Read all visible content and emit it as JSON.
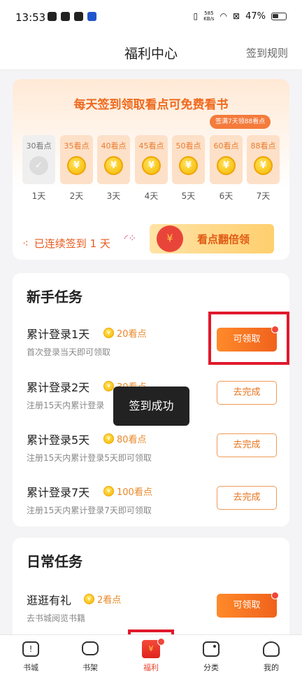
{
  "status_bar": {
    "time": "13:53",
    "net_speed_value": "585",
    "net_speed_unit": "KB/s",
    "battery": "47%"
  },
  "header": {
    "title": "福利中心",
    "rules_link": "签到规则"
  },
  "checkin": {
    "title": "每天签到领取看点可免费看书",
    "bonus_tag": "签满7天领88看点",
    "coin_symbol": "¥",
    "days": [
      {
        "points": "30看点",
        "label": "1天",
        "claimed": true
      },
      {
        "points": "35看点",
        "label": "2天",
        "claimed": false
      },
      {
        "points": "40看点",
        "label": "3天",
        "claimed": false
      },
      {
        "points": "45看点",
        "label": "4天",
        "claimed": false
      },
      {
        "points": "50看点",
        "label": "5天",
        "claimed": false
      },
      {
        "points": "60看点",
        "label": "6天",
        "claimed": false
      },
      {
        "points": "88看点",
        "label": "7天",
        "claimed": false
      }
    ],
    "streak_text": "已连续签到 1 天",
    "double_button": "看点翻倍领"
  },
  "newbie_tasks": {
    "title": "新手任务",
    "items": [
      {
        "name": "累计登录1天",
        "reward": "20看点",
        "desc": "首次登录当天即可领取",
        "button": "可领取"
      },
      {
        "name": "累计登录2天",
        "reward": "30看点",
        "desc": "注册15天内累计登录",
        "button": "去完成"
      },
      {
        "name": "累计登录5天",
        "reward": "80看点",
        "desc": "注册15天内累计登录5天即可领取",
        "button": "去完成"
      },
      {
        "name": "累计登录7天",
        "reward": "100看点",
        "desc": "注册15天内累计登录7天即可领取",
        "button": "去完成"
      }
    ]
  },
  "daily_tasks": {
    "title": "日常任务",
    "items": [
      {
        "name": "逛逛有礼",
        "reward": "2看点",
        "desc": "去书城阅览书籍",
        "button": "可领取"
      }
    ]
  },
  "toast": "签到成功",
  "tab_bar": {
    "items": [
      {
        "label": "书城",
        "icon": "book-icon"
      },
      {
        "label": "书架",
        "icon": "bookshelf-icon"
      },
      {
        "label": "福利",
        "icon": "gift-icon"
      },
      {
        "label": "分类",
        "icon": "category-icon"
      },
      {
        "label": "我的",
        "icon": "profile-icon"
      }
    ]
  },
  "colors": {
    "accent": "#f0621c",
    "highlight": "#e0192b"
  }
}
